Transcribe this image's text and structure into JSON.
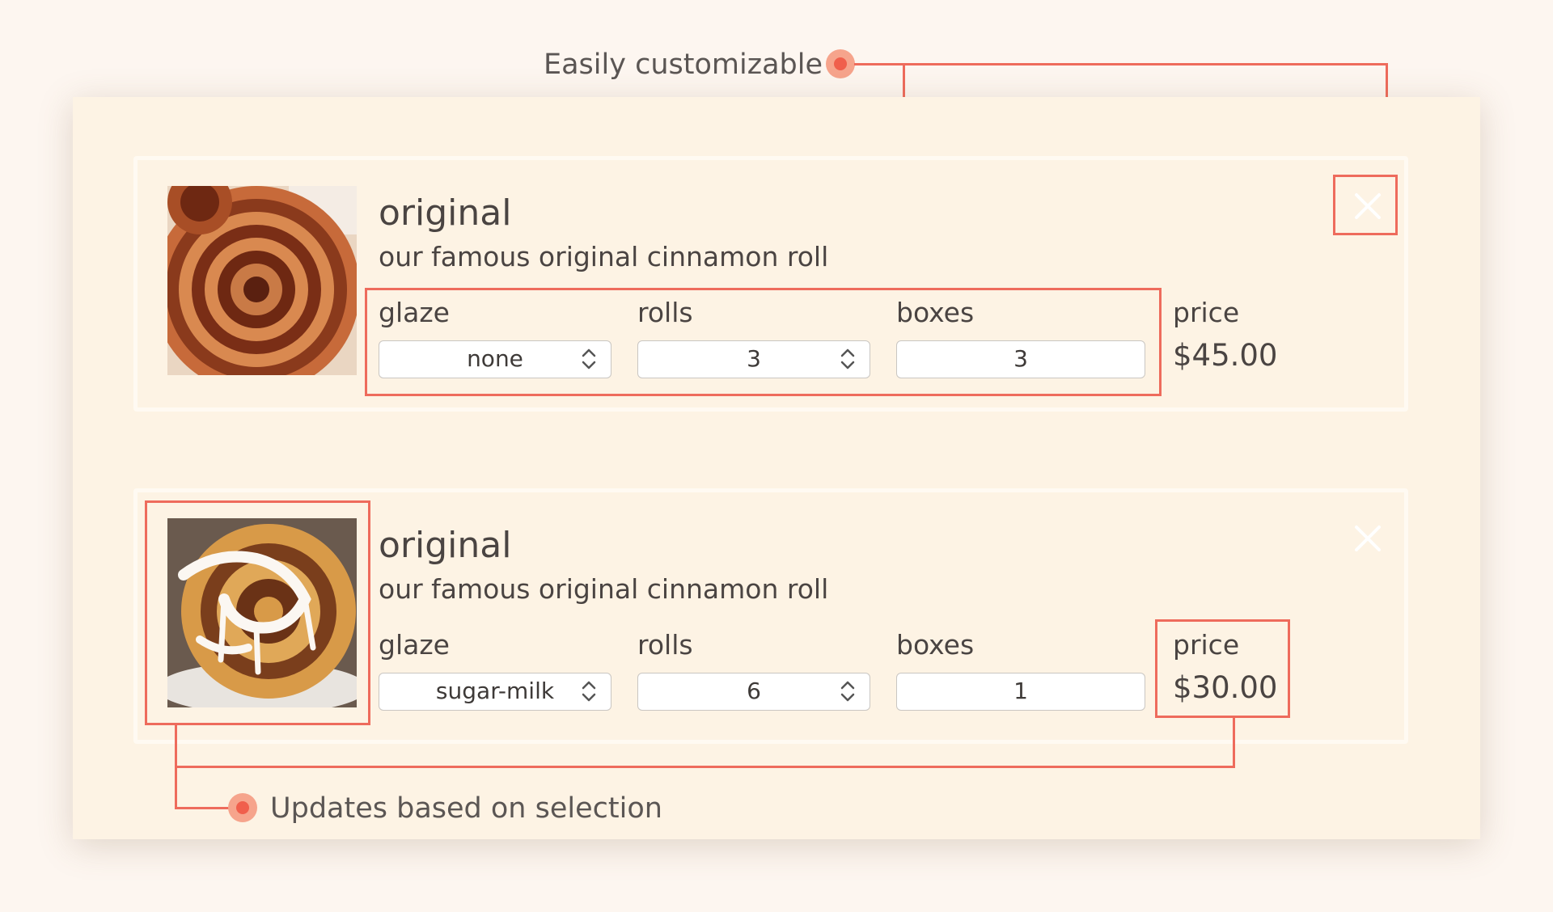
{
  "annotations": {
    "top": "Easily customizable",
    "bottom": "Updates based on selection"
  },
  "cart": {
    "items": [
      {
        "name": "original",
        "description": "our famous original cinnamon roll",
        "glaze_label": "glaze",
        "glaze_value": "none",
        "rolls_label": "rolls",
        "rolls_value": "3",
        "boxes_label": "boxes",
        "boxes_value": "3",
        "price_label": "price",
        "price_value": "$45.00",
        "image_icon": "cinnamon-roll-plain-photo"
      },
      {
        "name": "original",
        "description": "our famous original cinnamon roll",
        "glaze_label": "glaze",
        "glaze_value": "sugar-milk",
        "rolls_label": "rolls",
        "rolls_value": "6",
        "boxes_label": "boxes",
        "boxes_value": "1",
        "price_label": "price",
        "price_value": "$30.00",
        "image_icon": "cinnamon-roll-glazed-photo"
      }
    ],
    "close_icon": "close-icon"
  },
  "colors": {
    "page_bg": "#fdf6f0",
    "panel_bg": "#fdf3e4",
    "highlight": "#ee6b5c",
    "dot_outer": "#f6a48c",
    "dot_inner": "#f05f4c",
    "text": "#4a4442"
  }
}
